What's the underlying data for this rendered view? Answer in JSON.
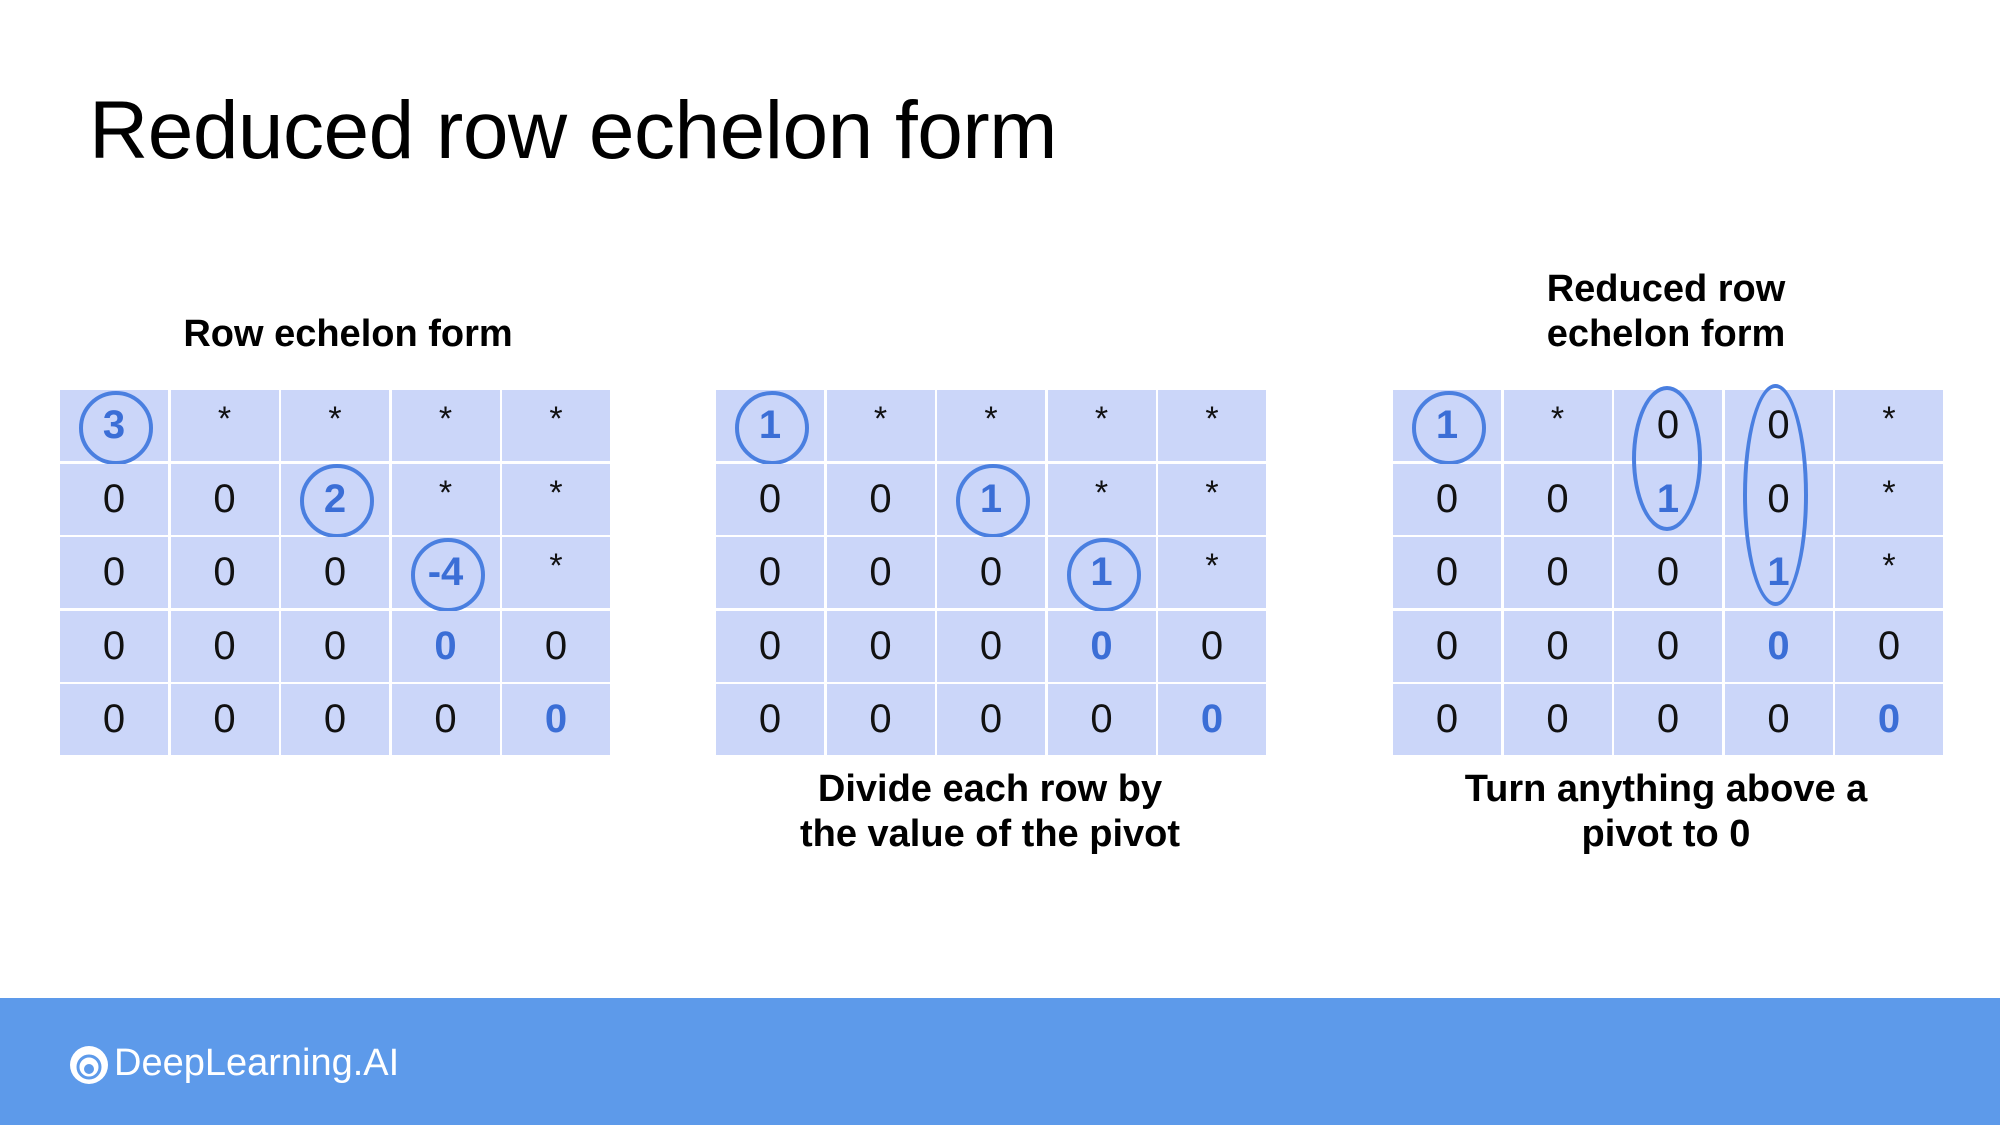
{
  "title": "Reduced row echelon form",
  "panels": [
    {
      "heading": [
        "Row echelon form"
      ],
      "caption": [],
      "matrix": [
        [
          "3",
          "*",
          "*",
          "*",
          "*"
        ],
        [
          "0",
          "0",
          "2",
          "*",
          "*"
        ],
        [
          "0",
          "0",
          "0",
          "-4",
          "*"
        ],
        [
          "0",
          "0",
          "0",
          "0",
          "0"
        ],
        [
          "0",
          "0",
          "0",
          "0",
          "0"
        ]
      ]
    },
    {
      "heading": [],
      "caption": [
        "Divide each row by",
        "the value of the pivot"
      ],
      "matrix": [
        [
          "1",
          "*",
          "*",
          "*",
          "*"
        ],
        [
          "0",
          "0",
          "1",
          "*",
          "*"
        ],
        [
          "0",
          "0",
          "0",
          "1",
          "*"
        ],
        [
          "0",
          "0",
          "0",
          "0",
          "0"
        ],
        [
          "0",
          "0",
          "0",
          "0",
          "0"
        ]
      ]
    },
    {
      "heading": [
        "Reduced row",
        "echelon form"
      ],
      "caption": [
        "Turn anything above a",
        "pivot to 0"
      ],
      "matrix": [
        [
          "1",
          "*",
          "0",
          "0",
          "*"
        ],
        [
          "0",
          "0",
          "1",
          "0",
          "*"
        ],
        [
          "0",
          "0",
          "0",
          "1",
          "*"
        ],
        [
          "0",
          "0",
          "0",
          "0",
          "0"
        ],
        [
          "0",
          "0",
          "0",
          "0",
          "0"
        ]
      ]
    }
  ],
  "colors": {
    "cell_background": "#cbd6f9",
    "pivot_blue": "#3b6ed6",
    "footer": "#5d9aea"
  },
  "footer": {
    "brand": "DeepLearning.AI",
    "logo_icon": "deeplearning-ai-logo-icon"
  }
}
